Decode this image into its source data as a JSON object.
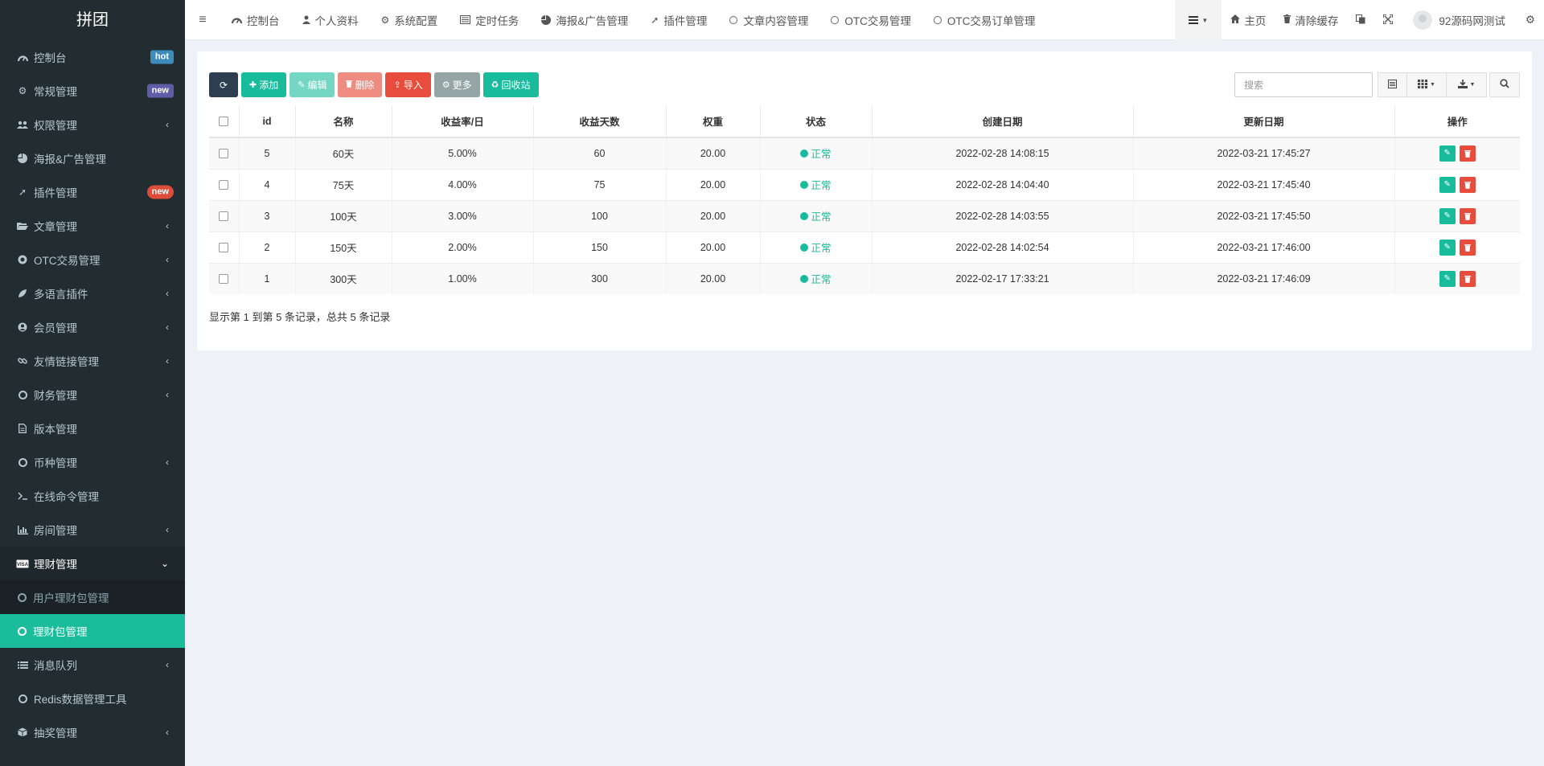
{
  "app": {
    "brand": "拼团"
  },
  "sidebar": {
    "items": [
      {
        "label": "控制台",
        "icon": "dashboard-icon",
        "badge": "hot"
      },
      {
        "label": "常规管理",
        "icon": "cogs-icon",
        "badge": "new"
      },
      {
        "label": "权限管理",
        "icon": "group-icon",
        "arrow": true
      },
      {
        "label": "海报&广告管理",
        "icon": "pie-chart-icon"
      },
      {
        "label": "插件管理",
        "icon": "rocket-icon",
        "badge": "new"
      },
      {
        "label": "文章管理",
        "icon": "folder-open-icon",
        "arrow": true
      },
      {
        "label": "OTC交易管理",
        "icon": "coin-icon",
        "arrow": true
      },
      {
        "label": "多语言插件",
        "icon": "leaf-icon",
        "arrow": true
      },
      {
        "label": "会员管理",
        "icon": "user-circle-icon",
        "arrow": true
      },
      {
        "label": "友情链接管理",
        "icon": "link-icon",
        "arrow": true
      },
      {
        "label": "财务管理",
        "icon": "circle-o-icon",
        "arrow": true
      },
      {
        "label": "版本管理",
        "icon": "file-text-icon"
      },
      {
        "label": "币种管理",
        "icon": "circle-o-icon",
        "arrow": true
      },
      {
        "label": "在线命令管理",
        "icon": "terminal-icon"
      },
      {
        "label": "房间管理",
        "icon": "bar-chart-icon",
        "arrow": true
      },
      {
        "label": "理财管理",
        "icon": "visa-icon",
        "arrow_down": true
      }
    ],
    "sub_items": [
      {
        "label": "用户理财包管理"
      },
      {
        "label": "理财包管理"
      }
    ],
    "items_after": [
      {
        "label": "消息队列",
        "icon": "list-icon",
        "arrow": true
      },
      {
        "label": "Redis数据管理工具",
        "icon": "circle-o-icon"
      },
      {
        "label": "抽奖管理",
        "icon": "cube-icon",
        "arrow": true
      }
    ]
  },
  "topnav": {
    "tabs": [
      "控制台",
      "个人资料",
      "系统配置",
      "定时任务",
      "海报&广告管理",
      "插件管理",
      "文章内容管理",
      "OTC交易管理",
      "OTC交易订单管理"
    ],
    "home": "主页",
    "clear_cache": "清除缓存",
    "user": "92源码网测试"
  },
  "toolbar": {
    "add": "添加",
    "edit": "编辑",
    "delete": "删除",
    "import": "导入",
    "more": "更多",
    "recycle": "回收站",
    "search_placeholder": "搜索"
  },
  "table": {
    "headers": [
      "id",
      "名称",
      "收益率/日",
      "收益天数",
      "权重",
      "状态",
      "创建日期",
      "更新日期",
      "操作"
    ],
    "rows": [
      {
        "id": "5",
        "name": "60天",
        "rate": "5.00%",
        "days": "60",
        "weight": "20.00",
        "status": "正常",
        "created": "2022-02-28 14:08:15",
        "updated": "2022-03-21 17:45:27"
      },
      {
        "id": "4",
        "name": "75天",
        "rate": "4.00%",
        "days": "75",
        "weight": "20.00",
        "status": "正常",
        "created": "2022-02-28 14:04:40",
        "updated": "2022-03-21 17:45:40"
      },
      {
        "id": "3",
        "name": "100天",
        "rate": "3.00%",
        "days": "100",
        "weight": "20.00",
        "status": "正常",
        "created": "2022-02-28 14:03:55",
        "updated": "2022-03-21 17:45:50"
      },
      {
        "id": "2",
        "name": "150天",
        "rate": "2.00%",
        "days": "150",
        "weight": "20.00",
        "status": "正常",
        "created": "2022-02-28 14:02:54",
        "updated": "2022-03-21 17:46:00"
      },
      {
        "id": "1",
        "name": "300天",
        "rate": "1.00%",
        "days": "300",
        "weight": "20.00",
        "status": "正常",
        "created": "2022-02-17 17:33:21",
        "updated": "2022-03-21 17:46:09"
      }
    ],
    "summary": "显示第 1 到第 5 条记录，总共 5 条记录"
  },
  "colors": {
    "sidebar": "#222d32",
    "accent": "#18bc9c",
    "danger": "#e74c3c"
  }
}
